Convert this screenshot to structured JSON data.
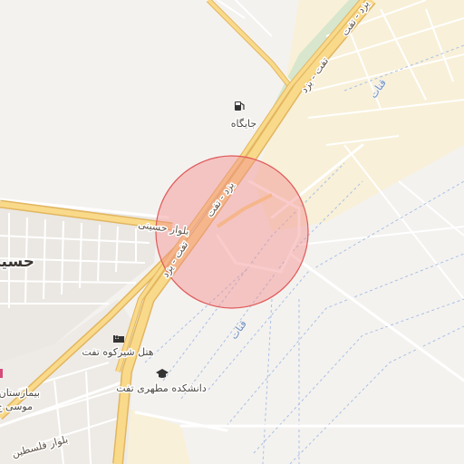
{
  "map": {
    "colors": {
      "background": "#f4f2ef",
      "landuse_yellow": "#f8f0d8",
      "urban_blocks": "#e9e6e1",
      "green_strip": "#d7e6cc",
      "highway_fill": "#f9d98a",
      "highway_casing": "#e2b660",
      "minor_road": "#ffffff",
      "qanat_dash": "#a8c0e6",
      "selection_fill": "#f28b8b",
      "selection_stroke": "#e05a5a"
    },
    "labels": {
      "highway_north": "یزد - تفت",
      "highway_center": "یزد - تفت",
      "highway_center_rev": "تفت - یزد",
      "highway_south": "تفت - یزد",
      "boulevard": "بلوار حسینی",
      "gas_station": "جایگاه",
      "qanat_east": "قنات",
      "qanat_center": "قنات",
      "hotel": "هتل شیرکوه تفت",
      "university": "دانشکده مطهری تفت",
      "hospital_line1": "بیمارستان",
      "hospital_line2": "موسی ج",
      "city_partial": "حسین",
      "street_sw": "بلوار فلسطین"
    },
    "icons": {
      "gas_station": "fuel-pump-icon",
      "hotel": "bed-icon",
      "university": "graduation-cap-icon",
      "hospital": "hospital-icon"
    }
  }
}
